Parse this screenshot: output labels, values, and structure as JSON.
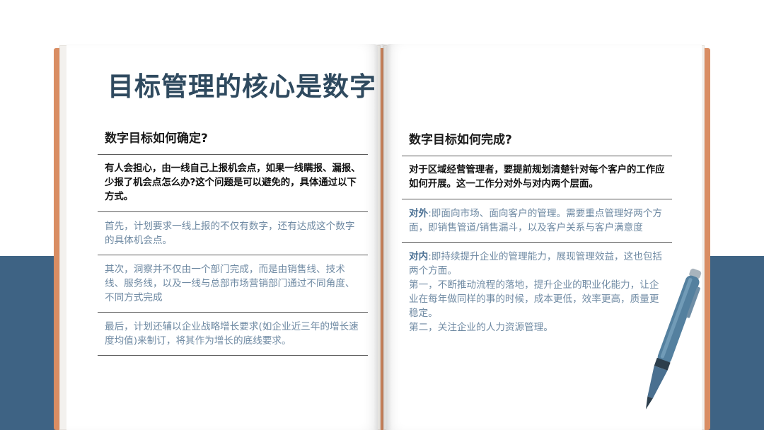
{
  "title": "目标管理的核心是数字",
  "left": {
    "heading": "数字目标如何确定?",
    "intro": "有人会担心，由一线自己上报机会点，如果一线瞒报、漏报、少报了机会点怎么办?这个问题是可以避免的，具体通过以下方式。",
    "points": [
      "首先，计划要求一线上报的不仅有数字，还有达成这个数字的具体机会点。",
      "其次，洞察并不仅由一个部门完成，而是由销售线、技术线、服务线，以及一线与总部市场营销部门通过不同角度、不同方式完成",
      "最后，计划还辅以企业战略增长要求(如企业近三年的增长速度均值)来制订，将其作为增长的底线要求。"
    ]
  },
  "right": {
    "heading": "数字目标如何完成?",
    "intro": "对于区域经营管理者，要提前规划清楚针对每个客户的工作应如何开展。这一工作分对外与对内两个层面。",
    "external_label": "对外",
    "external_text": ":即面向市场、面向客户的管理。需要重点管理好两个方面，即销售管道/销售漏斗，以及客户关系与客户满意度",
    "internal_label": "对内",
    "internal_text": ":即持续提升企业的管理能力，展现管理效益，这也包括两个方面。",
    "internal_first": "第一，不断推动流程的落地，提升企业的职业化能力，让企业在每年做同样的事的时候，成本更低，效率更高，质量更稳定。",
    "internal_second": "第二，关注企业的人力资源管理。"
  },
  "colors": {
    "title": "#2f4a5f",
    "body_text": "#6f8aa3",
    "accent_label": "#4e7396",
    "band": "#3e6384",
    "book_cover": "#d98d63"
  },
  "icons": [
    "pen-icon"
  ]
}
